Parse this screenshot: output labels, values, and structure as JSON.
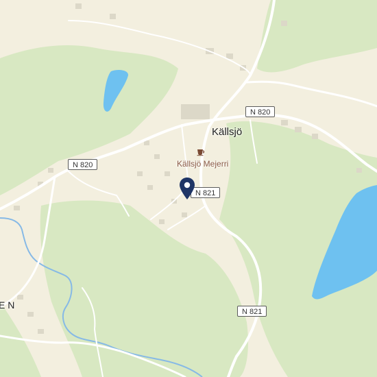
{
  "map": {
    "place_label": "Källsjö",
    "partial_place_label": "E N",
    "poi": {
      "label": "Källsjö Mejerri",
      "icon": "cafe-icon"
    },
    "road_labels": {
      "n820_left": "N 820",
      "n820_top": "N 820",
      "n821_pin": "N 821",
      "n821_bottom": "N 821"
    },
    "marker": {
      "icon": "location-pin-icon",
      "color": "#1f3566"
    },
    "colors": {
      "land": "#f3efdf",
      "forest": "#d8e8c2",
      "water": "#6ec1f0",
      "river": "#86b9e6",
      "road": "#ffffff",
      "building": "#dcd8c8"
    }
  }
}
